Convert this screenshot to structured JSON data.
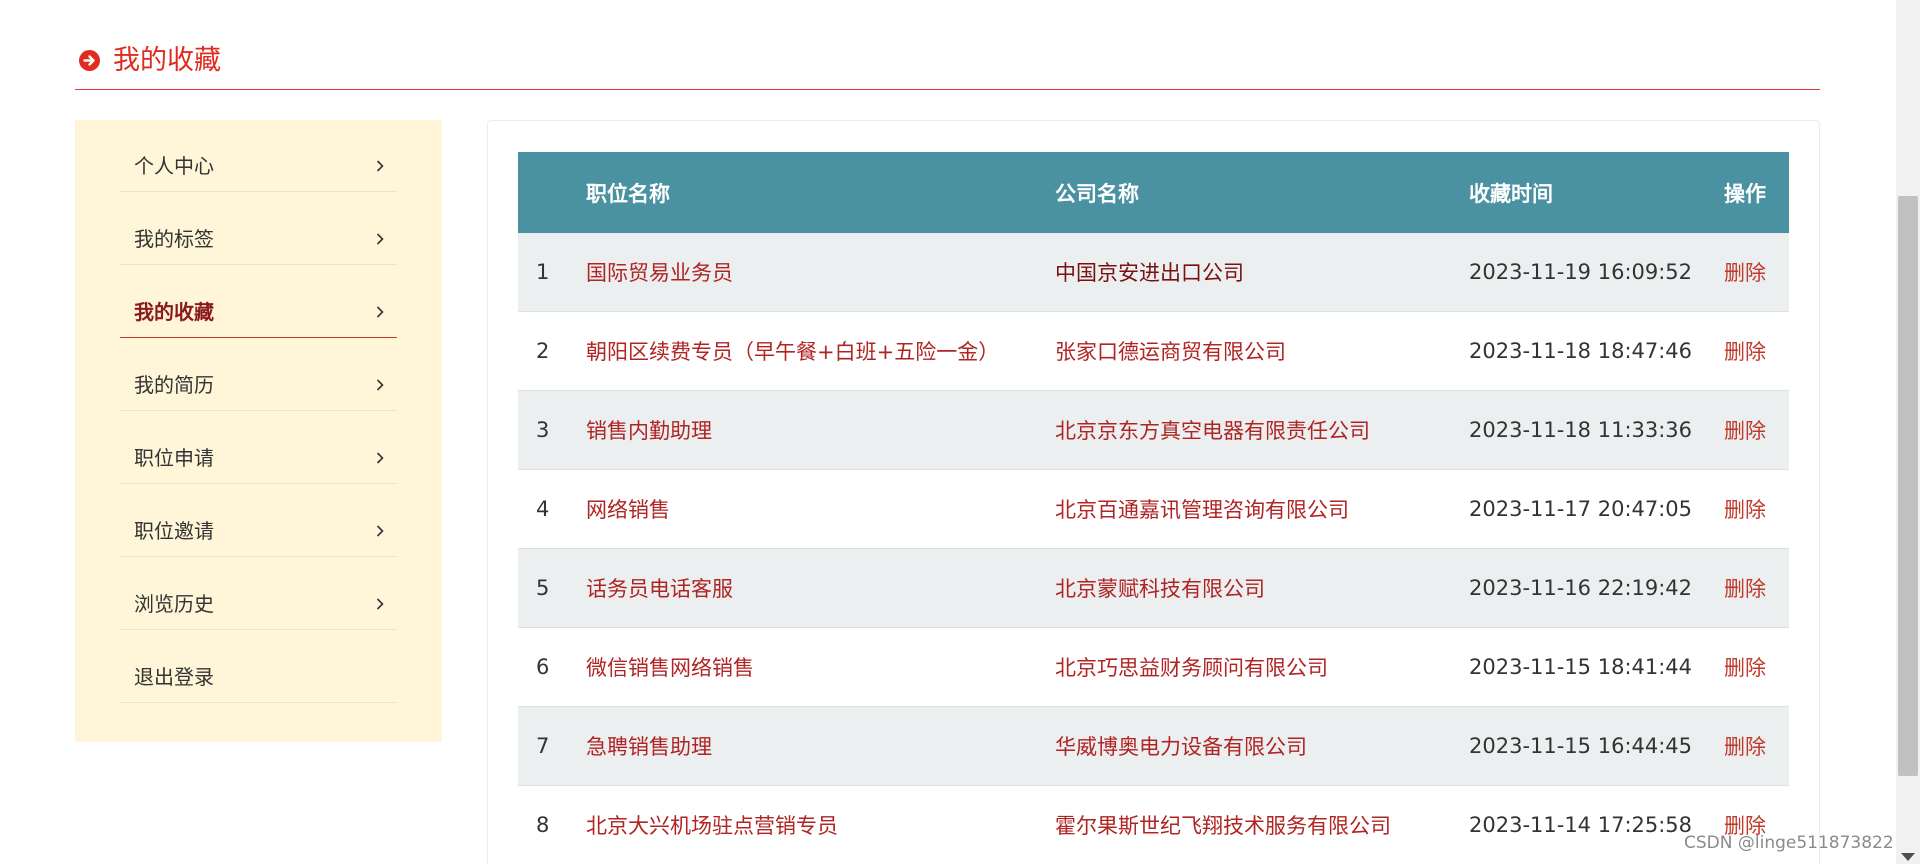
{
  "header": {
    "title": "我的收藏",
    "icon": "arrow-circle-right-icon",
    "accent_color": "#e02b20"
  },
  "sidebar": {
    "items": [
      {
        "label": "个人中心",
        "active": false,
        "has_chevron": true
      },
      {
        "label": "我的标签",
        "active": false,
        "has_chevron": true
      },
      {
        "label": "我的收藏",
        "active": true,
        "has_chevron": true
      },
      {
        "label": "我的简历",
        "active": false,
        "has_chevron": true
      },
      {
        "label": "职位申请",
        "active": false,
        "has_chevron": true
      },
      {
        "label": "职位邀请",
        "active": false,
        "has_chevron": true
      },
      {
        "label": "浏览历史",
        "active": false,
        "has_chevron": true
      },
      {
        "label": "退出登录",
        "active": false,
        "has_chevron": false
      }
    ],
    "background": "#fff6d9"
  },
  "table": {
    "header_color": "#4a92a1",
    "columns": {
      "title": "职位名称",
      "company": "公司名称",
      "time": "收藏时间",
      "op": "操作"
    },
    "rows": [
      {
        "idx": "1",
        "title": "国际贸易业务员",
        "company": "中国京安进出口公司",
        "time": "2023-11-19 16:09:52",
        "op": "删除"
      },
      {
        "idx": "2",
        "title": "朝阳区续费专员（早午餐+白班+五险一金）",
        "company": "张家口德运商贸有限公司",
        "time": "2023-11-18 18:47:46",
        "op": "删除"
      },
      {
        "idx": "3",
        "title": "销售内勤助理",
        "company": "北京京东方真空电器有限责任公司",
        "time": "2023-11-18 11:33:36",
        "op": "删除"
      },
      {
        "idx": "4",
        "title": "网络销售",
        "company": "北京百通嘉讯管理咨询有限公司",
        "time": "2023-11-17 20:47:05",
        "op": "删除"
      },
      {
        "idx": "5",
        "title": "话务员电话客服",
        "company": "北京蒙赋科技有限公司",
        "time": "2023-11-16 22:19:42",
        "op": "删除"
      },
      {
        "idx": "6",
        "title": "微信销售网络销售",
        "company": "北京巧思益财务顾问有限公司",
        "time": "2023-11-15 18:41:44",
        "op": "删除"
      },
      {
        "idx": "7",
        "title": "急聘销售助理",
        "company": "华威博奥电力设备有限公司",
        "time": "2023-11-15 16:44:45",
        "op": "删除"
      },
      {
        "idx": "8",
        "title": "北京大兴机场驻点营销专员",
        "company": "霍尔果斯世纪飞翔技术服务有限公司",
        "time": "2023-11-14 17:25:58",
        "op": "删除"
      }
    ]
  },
  "watermark": "CSDN @linge511873822"
}
